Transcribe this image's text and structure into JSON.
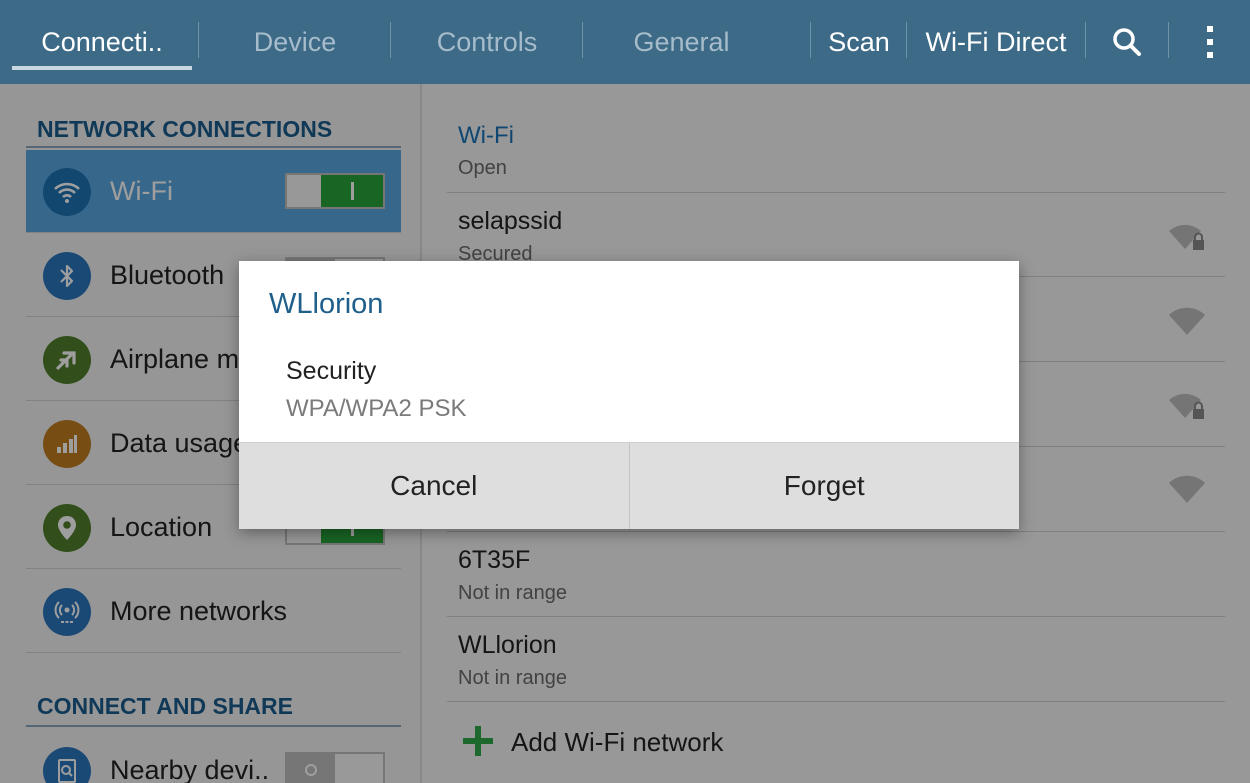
{
  "topbar": {
    "tabs": [
      {
        "label": "Connecti.."
      },
      {
        "label": "Device"
      },
      {
        "label": "Controls"
      },
      {
        "label": "General"
      }
    ],
    "scan_label": "Scan",
    "wifi_direct_label": "Wi-Fi Direct",
    "search_icon": "search-icon",
    "overflow_icon": "overflow-menu-icon"
  },
  "sidebar": {
    "section1": "NETWORK CONNECTIONS",
    "items": [
      {
        "label": "Wi-Fi",
        "icon": "wifi-icon",
        "toggle": "on"
      },
      {
        "label": "Bluetooth",
        "icon": "bluetooth-icon",
        "toggle": "off"
      },
      {
        "label": "Airplane mode",
        "icon": "airplane-icon"
      },
      {
        "label": "Data usage",
        "icon": "data-usage-icon"
      },
      {
        "label": "Location",
        "icon": "location-icon",
        "toggle": "on"
      },
      {
        "label": "More networks",
        "icon": "more-networks-icon"
      }
    ],
    "section2": "CONNECT AND SHARE",
    "share_items": [
      {
        "label": "Nearby devi..",
        "icon": "nearby-devices-icon",
        "toggle": "off"
      }
    ]
  },
  "wifi": {
    "header": "Wi-Fi",
    "networks": [
      {
        "name": "",
        "status": "Open"
      },
      {
        "name": "selapssid",
        "status": "Secured",
        "signal": "secured"
      },
      {
        "name": "",
        "status": "",
        "signal": "open"
      },
      {
        "name": "",
        "status": "",
        "signal": "secured"
      },
      {
        "name": "",
        "status": "",
        "signal": "open"
      },
      {
        "name": "6T35F",
        "status": "Not in range"
      },
      {
        "name": "WLlorion",
        "status": "Not in range"
      }
    ],
    "add_label": "Add Wi-Fi network"
  },
  "dialog": {
    "title": "WLlorion",
    "security_label": "Security",
    "security_value": "WPA/WPA2 PSK",
    "cancel_label": "Cancel",
    "forget_label": "Forget"
  },
  "colors": {
    "topbar": "#3c6a87",
    "accent": "#1a73b8",
    "toggle_on": "#29a33b",
    "selected_row": "#5aa8e0"
  }
}
